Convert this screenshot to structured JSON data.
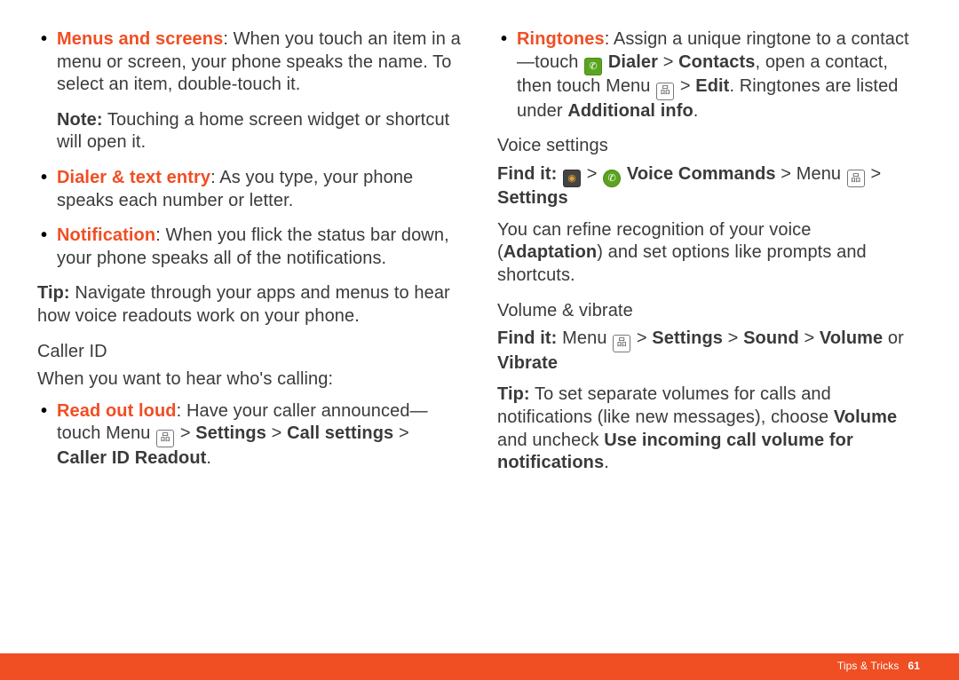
{
  "left": {
    "bullets": [
      {
        "label": "Menus and screens",
        "text": ": When you touch an item in a menu or screen, your phone speaks the name. To select an item, double-touch it.",
        "note_label": "Note:",
        "note_text": " Touching a home screen widget or shortcut will open it."
      },
      {
        "label": "Dialer & text entry",
        "text": ": As you type, your phone speaks each number or letter."
      },
      {
        "label": "Notification",
        "text": ": When you flick the status bar down, your phone speaks all of the notifications."
      }
    ],
    "tip_label": "Tip:",
    "tip_text": " Navigate through your apps and menus to hear how voice readouts work on your phone.",
    "heading": "Caller ID",
    "subtext": "When you want to hear who's calling:",
    "bullets2": [
      {
        "label": "Read out loud",
        "pre": ": Have your caller announced—touch Menu ",
        "mid": " > ",
        "settings": "Settings",
        "line2a": " > ",
        "line2b": "Call settings",
        "line2c": " > ",
        "line2d": "Caller ID Readout",
        "line2e": "."
      }
    ]
  },
  "right": {
    "bullets": [
      {
        "label": "Ringtones",
        "pre": ": Assign a unique ringtone to a contact—touch ",
        "dialer": " Dialer",
        "gt1": " > ",
        "contacts": "Contacts",
        "post1": ", open a contact, then touch Menu ",
        "gt2": " > ",
        "edit": "Edit",
        "post2": ". Ringtones are listed under ",
        "addinfo": "Additional info",
        "dot": "."
      }
    ],
    "h1": "Voice settings",
    "findit1a": "Find it:",
    "findit1b": " > ",
    "vc": " Voice Commands",
    "findit1c": " > Menu ",
    "findit1d": " > ",
    "settings": "Settings",
    "body1a": "You can refine recognition of your voice (",
    "body1b": "Adaptation",
    "body1c": ") and set options like prompts and shortcuts.",
    "h2": "Volume & vibrate",
    "findit2a": "Find it:",
    "findit2b": " Menu ",
    "findit2c": " > ",
    "settings2": "Settings",
    "findit2d": " > ",
    "sound": "Sound",
    "findit2e": " > ",
    "volume": "Volume",
    "or": " or ",
    "vibrate": "Vibrate",
    "tip2a": "Tip:",
    "tip2b": " To set separate volumes for calls and notifications (like new messages), choose ",
    "tip2c": "Volume",
    "tip2d": " and uncheck ",
    "tip2e": "Use incoming call volume for notifications",
    "tip2f": "."
  },
  "footer": {
    "section": "Tips & Tricks",
    "page": "61"
  }
}
